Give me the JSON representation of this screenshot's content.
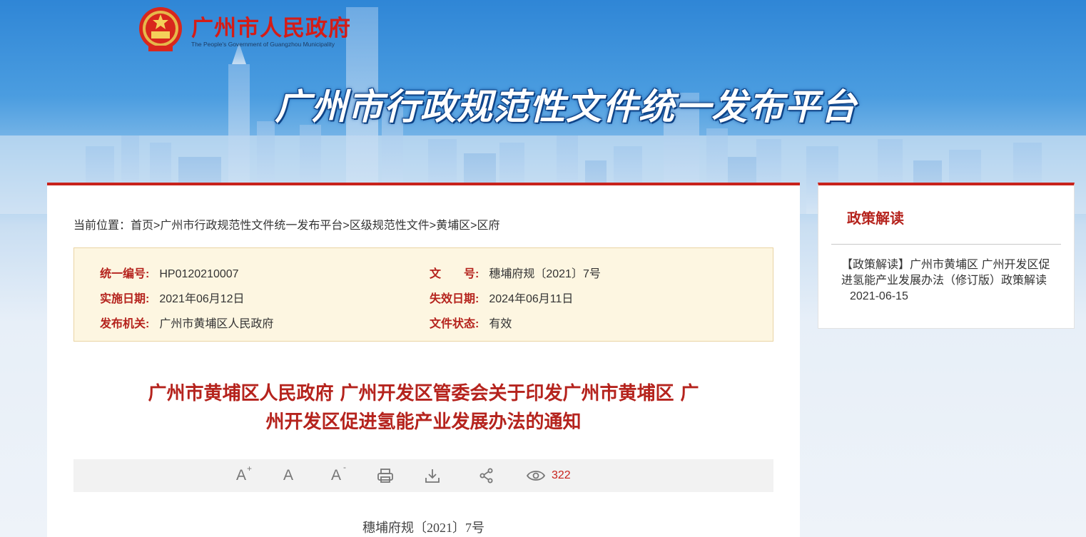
{
  "header": {
    "gov_name": "广州市人民政府",
    "gov_name_en": "The People's Government of Guangzhou Municipality",
    "platform_title": "广州市行政规范性文件统一发布平台",
    "emblem_icon": "national-emblem-icon"
  },
  "breadcrumb": {
    "prefix": "当前位置：",
    "items": [
      "首页",
      "广州市行政规范性文件统一发布平台",
      "区级规范性文件",
      "黄埔区",
      "区府"
    ],
    "separator": ">"
  },
  "info": {
    "unified_no_label": "统一编号:",
    "unified_no": "HP0120210007",
    "doc_no_label": "文　　号:",
    "doc_no": "穗埔府规〔2021〕7号",
    "effective_label": "实施日期:",
    "effective_date": "2021年06月12日",
    "expire_label": "失效日期:",
    "expire_date": "2024年06月11日",
    "issuer_label": "发布机关:",
    "issuer": "广州市黄埔区人民政府",
    "status_label": "文件状态:",
    "status": "有效"
  },
  "document": {
    "title_line1": "广州市黄埔区人民政府 广州开发区管委会关于印发广州市黄埔区 广",
    "title_line2": "州开发区促进氢能产业发展办法的通知",
    "number": "穗埔府规〔2021〕7号"
  },
  "toolbar": {
    "font_increase": "A",
    "font_default": "A",
    "font_decrease": "A",
    "views": "322",
    "icons": [
      "font-increase-icon",
      "font-default-icon",
      "font-decrease-icon",
      "print-icon",
      "download-icon",
      "share-icon",
      "eye-icon"
    ]
  },
  "sidebar": {
    "title": "政策解读",
    "items": [
      {
        "text": "【政策解读】广州市黄埔区 广州开发区促进氢能产业发展办法（修订版）政策解读",
        "date": "2021-06-15"
      }
    ]
  },
  "colors": {
    "accent_red": "#c8221c",
    "title_red": "#b5231d",
    "info_bg": "#fdf6e1"
  }
}
